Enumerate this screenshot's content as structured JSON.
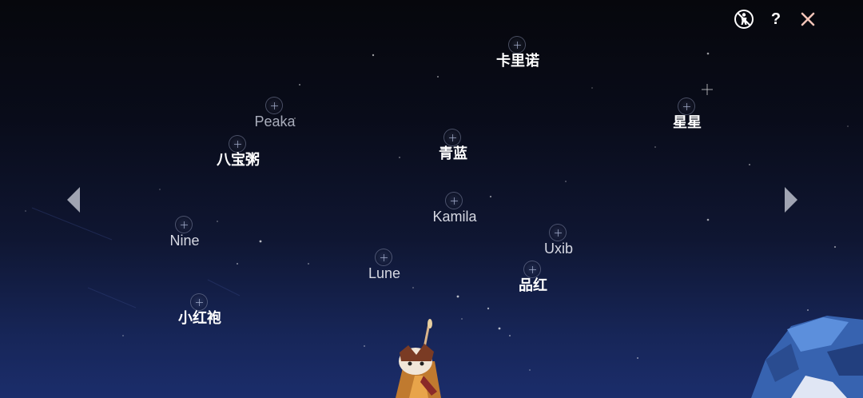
{
  "friends": [
    {
      "name": "卡里诺",
      "style": "bright"
    },
    {
      "name": "星星",
      "style": "bright"
    },
    {
      "name": "Peaka",
      "style": "dim"
    },
    {
      "name": "八宝粥",
      "style": "bright"
    },
    {
      "name": "青蓝",
      "style": "bright"
    },
    {
      "name": "Kamila",
      "style": "normal"
    },
    {
      "name": "Nine",
      "style": "normal"
    },
    {
      "name": "Uxib",
      "style": "normal"
    },
    {
      "name": "Lune",
      "style": "normal"
    },
    {
      "name": "品红",
      "style": "bright"
    },
    {
      "name": "小红袍",
      "style": "bright"
    }
  ],
  "controls": {
    "help_label": "?"
  },
  "icons": {
    "accessibility": "no-entry-person-icon",
    "help": "question-mark-icon",
    "close": "close-icon",
    "prev": "triangle-left-icon",
    "next": "triangle-right-icon"
  },
  "colors": {
    "sky_top": "#06070c",
    "sky_bottom": "#1b2d6b",
    "label": "#ffffff",
    "close_x": "#f2c4b8"
  }
}
